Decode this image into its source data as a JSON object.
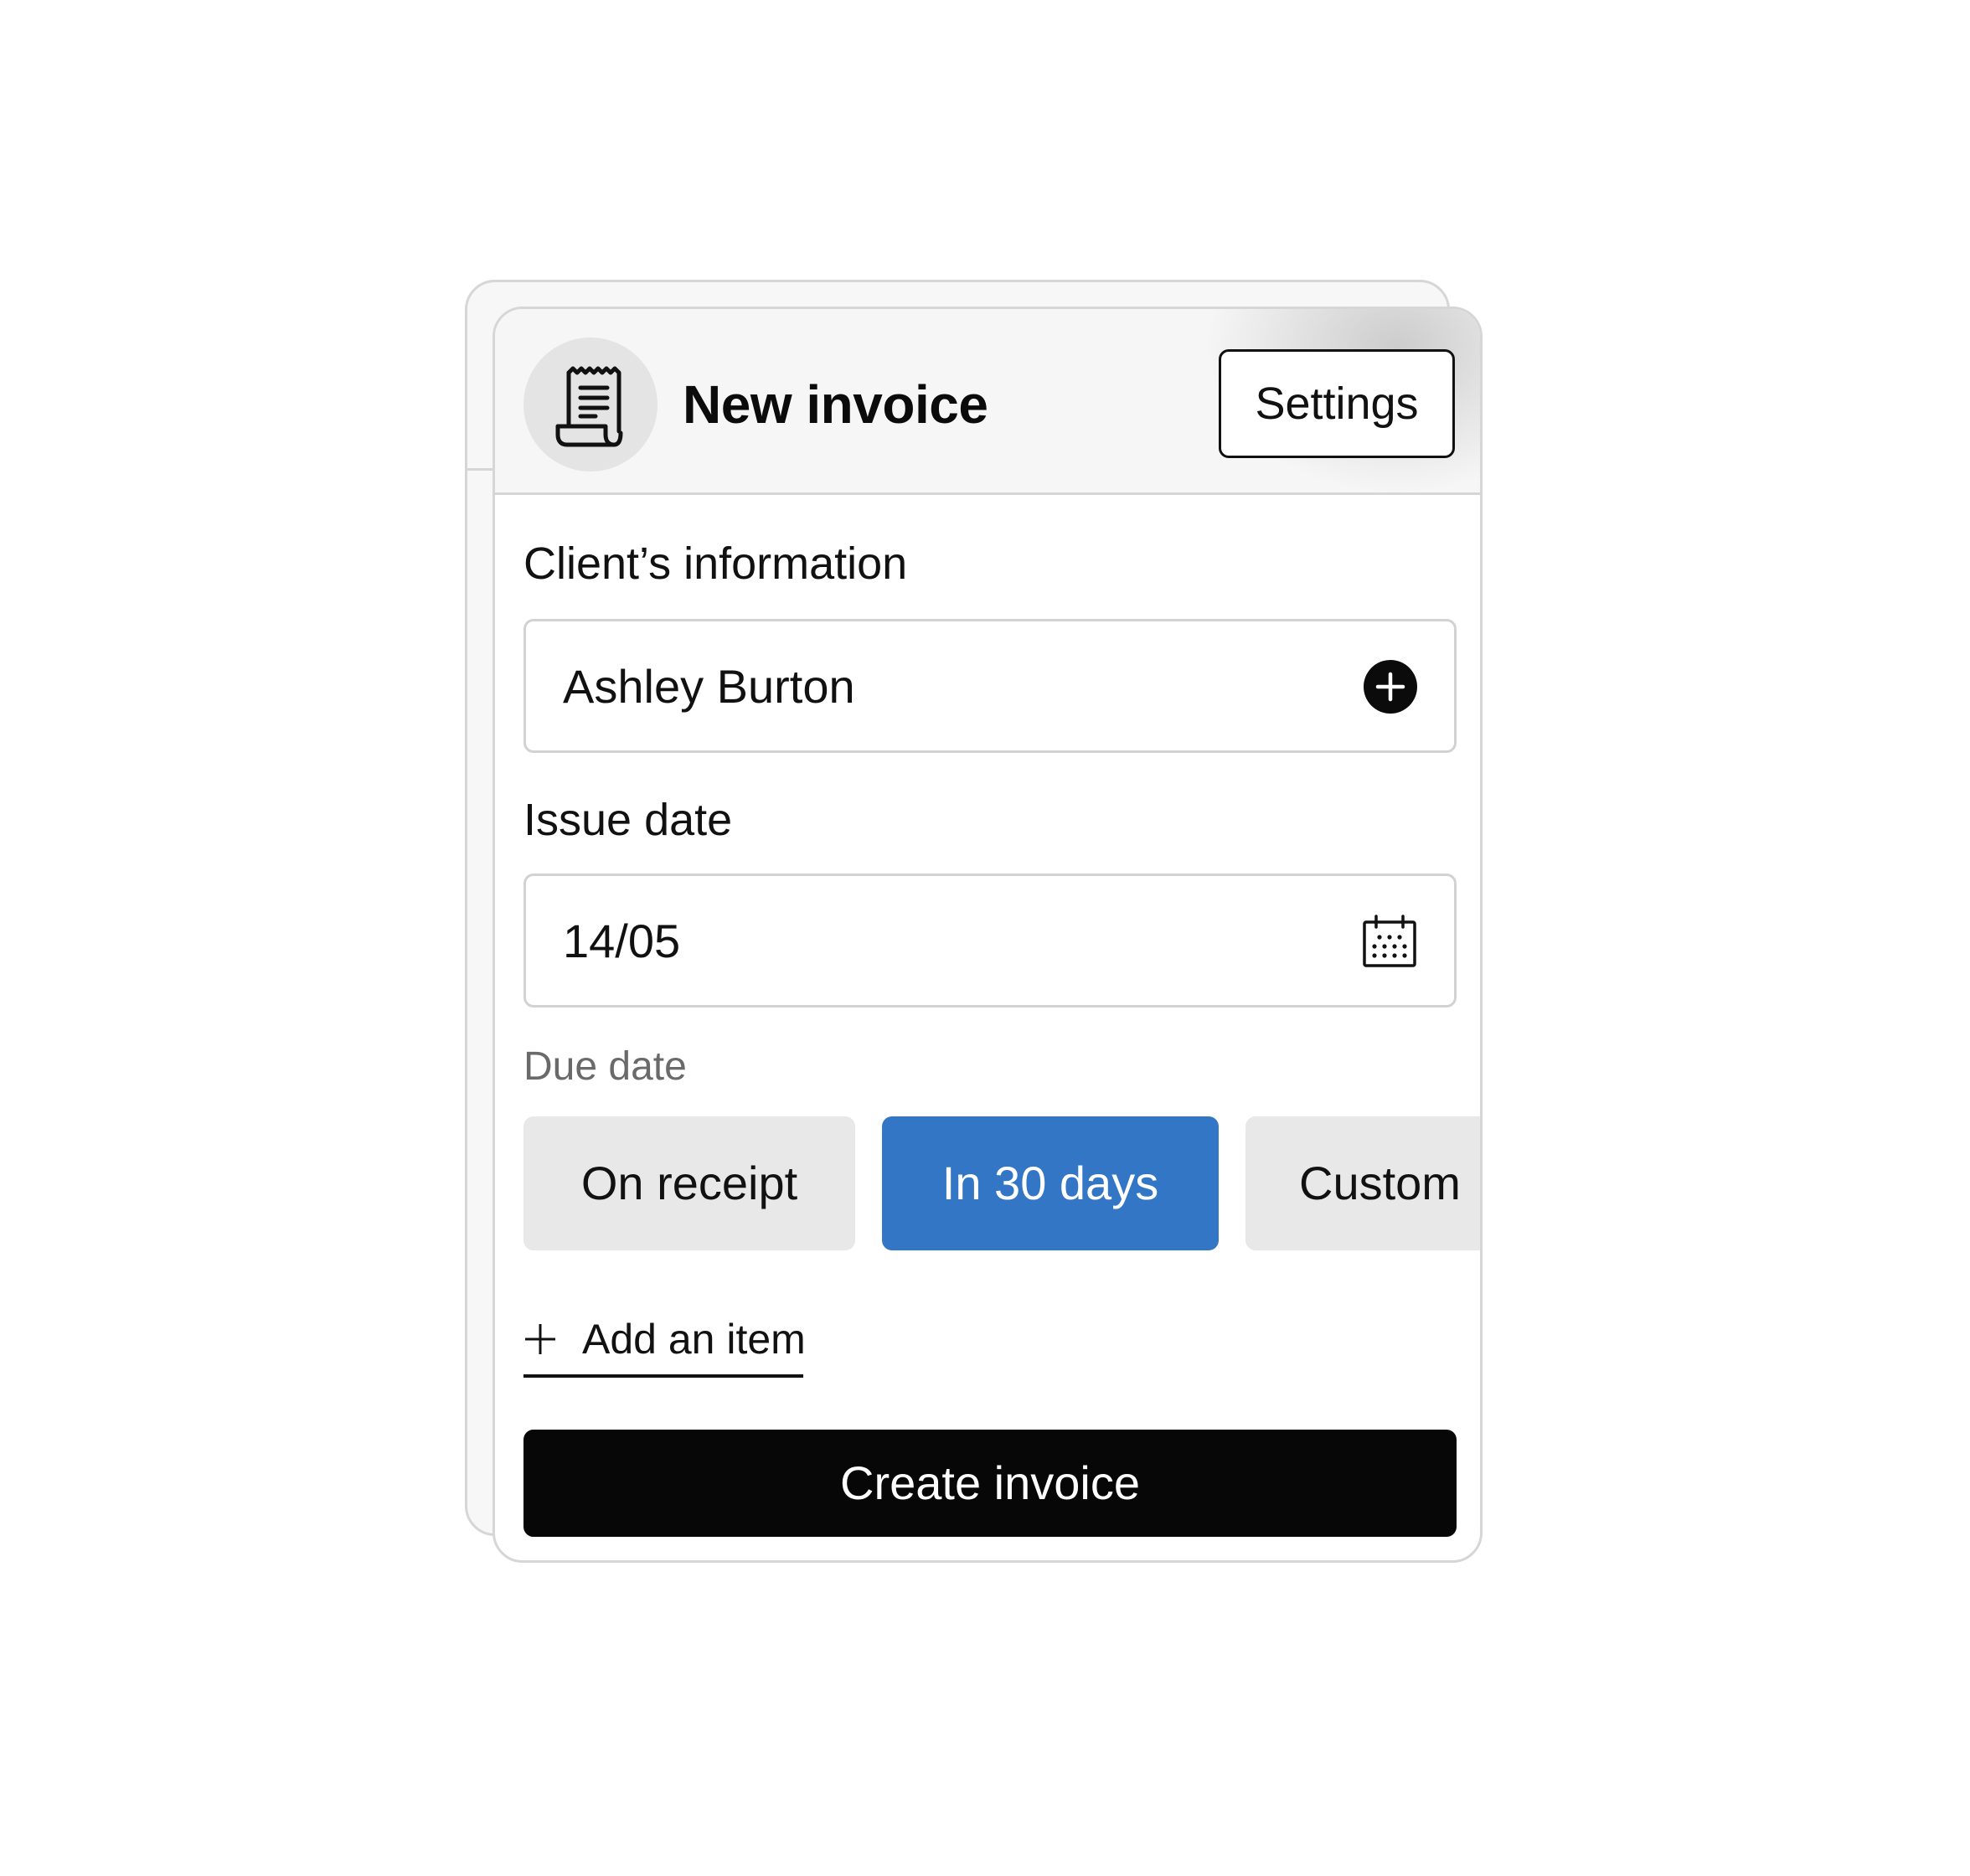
{
  "header": {
    "title": "New invoice",
    "settings_label": "Settings",
    "icon": "receipt-icon"
  },
  "client": {
    "label": "Client’s information",
    "value": "Ashley Burton",
    "action_icon": "plus-circle-icon"
  },
  "issue_date": {
    "label": "Issue date",
    "value": "14/05",
    "icon": "calendar-icon"
  },
  "due_date": {
    "label": "Due date",
    "options": [
      "On receipt",
      "In 30 days",
      "Custom"
    ],
    "selected": "In 30 days"
  },
  "add_item": {
    "label": "Add an item",
    "icon": "plus-icon"
  },
  "create_label": "Create invoice",
  "colors": {
    "accent": "#3376c6",
    "primary_button": "#070707",
    "segment_bg": "#e8e8e8",
    "border": "#d2d2d2"
  }
}
